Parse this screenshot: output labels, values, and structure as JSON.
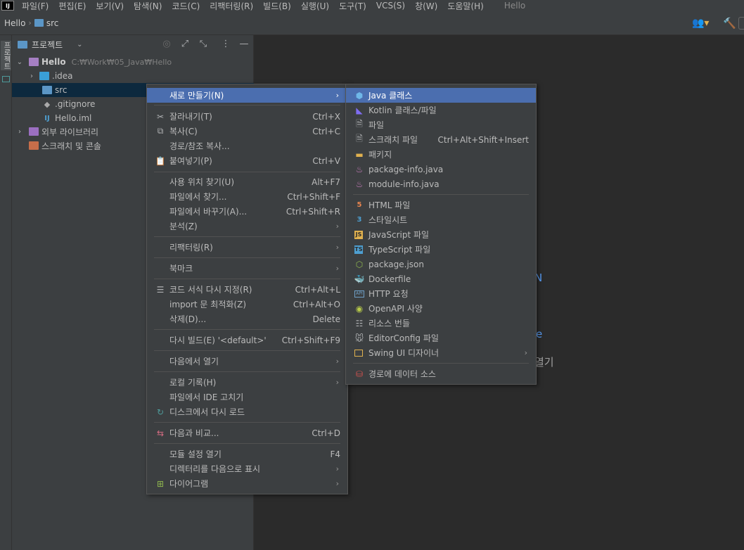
{
  "menubar": {
    "logo": "IJ",
    "items": [
      "파일(F)",
      "편집(E)",
      "보기(V)",
      "탐색(N)",
      "코드(C)",
      "리팩터링(R)",
      "빌드(B)",
      "실행(U)",
      "도구(T)",
      "VCS(S)",
      "창(W)",
      "도움말(H)"
    ],
    "title": "Hello"
  },
  "navbar": {
    "project": "Hello",
    "folder": "src"
  },
  "stripe": {
    "label": "프로젝트"
  },
  "project_panel": {
    "title": "프로젝트",
    "tree": [
      {
        "label": "Hello",
        "hint": "C:₩Work₩05_Java₩Hello"
      },
      {
        "label": ".idea"
      },
      {
        "label": "src"
      },
      {
        "label": ".gitignore"
      },
      {
        "label": "Hello.iml"
      },
      {
        "label": "외부 라이브러리"
      },
      {
        "label": "스크래치 및 콘솔"
      }
    ]
  },
  "editor": {
    "frag1": "N",
    "frag2": "e",
    "frag3": "열기"
  },
  "context_menu": {
    "items": [
      {
        "label": "새로 만들기(N)",
        "shortcut": ""
      },
      {
        "label": "잘라내기(T)",
        "shortcut": "Ctrl+X"
      },
      {
        "label": "복사(C)",
        "shortcut": "Ctrl+C"
      },
      {
        "label": "경로/참조 복사...",
        "shortcut": ""
      },
      {
        "label": "붙여넣기(P)",
        "shortcut": "Ctrl+V"
      },
      {
        "label": "사용 위치 찾기(U)",
        "shortcut": "Alt+F7"
      },
      {
        "label": "파일에서 찾기...",
        "shortcut": "Ctrl+Shift+F"
      },
      {
        "label": "파일에서 바꾸기(A)...",
        "shortcut": "Ctrl+Shift+R"
      },
      {
        "label": "분석(Z)",
        "shortcut": ""
      },
      {
        "label": "리팩터링(R)",
        "shortcut": ""
      },
      {
        "label": "북마크",
        "shortcut": ""
      },
      {
        "label": "코드 서식 다시 지정(R)",
        "shortcut": "Ctrl+Alt+L"
      },
      {
        "label": "import 문 최적화(Z)",
        "shortcut": "Ctrl+Alt+O"
      },
      {
        "label": "삭제(D)...",
        "shortcut": "Delete"
      },
      {
        "label": "다시 빌드(E) '<default>'",
        "shortcut": "Ctrl+Shift+F9"
      },
      {
        "label": "다음에서 열기",
        "shortcut": ""
      },
      {
        "label": "로컬 기록(H)",
        "shortcut": ""
      },
      {
        "label": "파일에서 IDE 고치기",
        "shortcut": ""
      },
      {
        "label": "디스크에서 다시 로드",
        "shortcut": ""
      },
      {
        "label": "다음과 비교...",
        "shortcut": "Ctrl+D"
      },
      {
        "label": "모듈 설정 열기",
        "shortcut": "F4"
      },
      {
        "label": "디렉터리를 다음으로 표시",
        "shortcut": ""
      },
      {
        "label": "다이어그램",
        "shortcut": ""
      }
    ]
  },
  "submenu": {
    "items": [
      {
        "label": "Java 클래스",
        "shortcut": ""
      },
      {
        "label": "Kotlin 클래스/파일",
        "shortcut": ""
      },
      {
        "label": "파일",
        "shortcut": ""
      },
      {
        "label": "스크래치 파일",
        "shortcut": "Ctrl+Alt+Shift+Insert"
      },
      {
        "label": "패키지",
        "shortcut": ""
      },
      {
        "label": "package-info.java",
        "shortcut": ""
      },
      {
        "label": "module-info.java",
        "shortcut": ""
      },
      {
        "label": "HTML 파일",
        "shortcut": ""
      },
      {
        "label": "스타일시트",
        "shortcut": ""
      },
      {
        "label": "JavaScript 파일",
        "shortcut": ""
      },
      {
        "label": "TypeScript 파일",
        "shortcut": ""
      },
      {
        "label": "package.json",
        "shortcut": ""
      },
      {
        "label": "Dockerfile",
        "shortcut": ""
      },
      {
        "label": "HTTP 요청",
        "shortcut": ""
      },
      {
        "label": "OpenAPI 사양",
        "shortcut": ""
      },
      {
        "label": "리소스 번들",
        "shortcut": ""
      },
      {
        "label": "EditorConfig 파일",
        "shortcut": ""
      },
      {
        "label": "Swing UI 디자이너",
        "shortcut": ""
      },
      {
        "label": "경로에 데이터 소스",
        "shortcut": ""
      }
    ]
  },
  "colors": {
    "selection": "#4b6eaf",
    "panel": "#3c3f41",
    "editor": "#2b2b2b",
    "link": "#589df6"
  }
}
